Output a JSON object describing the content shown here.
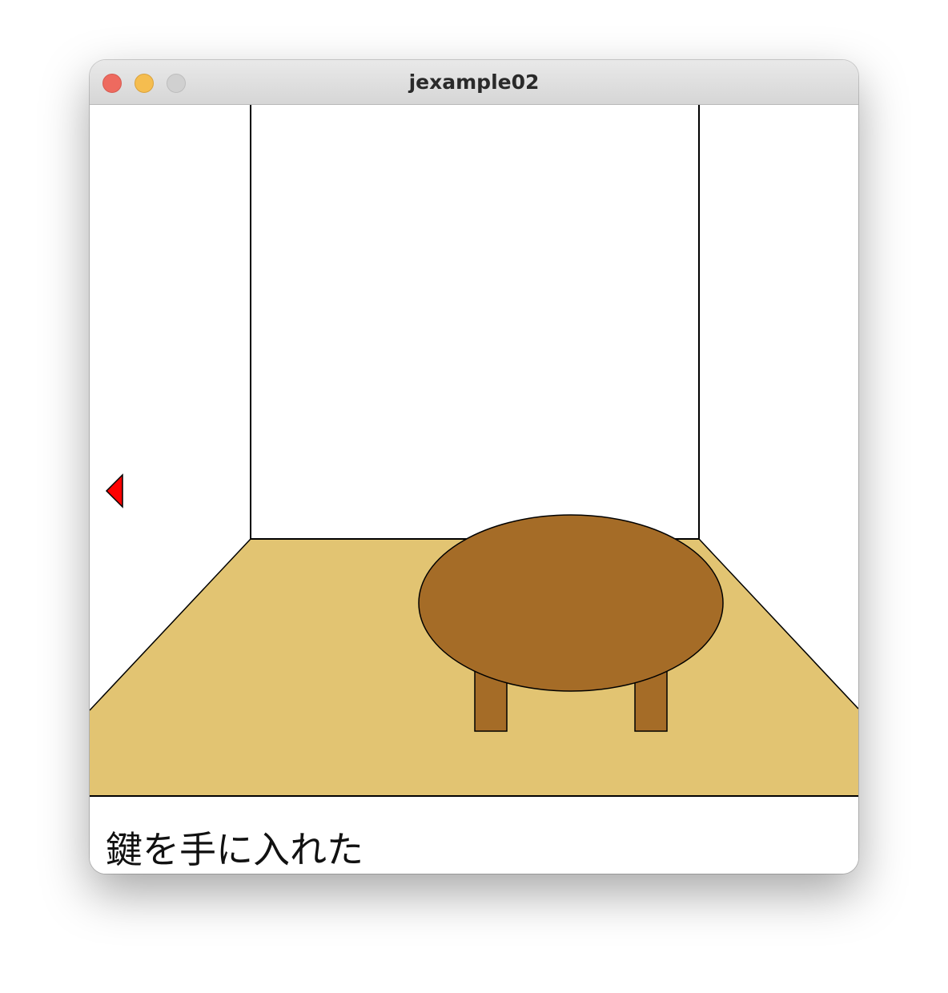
{
  "window": {
    "title": "jexample02",
    "controls": [
      "close",
      "minimize",
      "zoom"
    ]
  },
  "scene": {
    "floor_color": "#E2C472",
    "table_color": "#A56C27",
    "arrow_color": "#FF0000",
    "arrow_icon": "left-arrow-icon"
  },
  "message": {
    "text": "鍵を手に入れた"
  }
}
